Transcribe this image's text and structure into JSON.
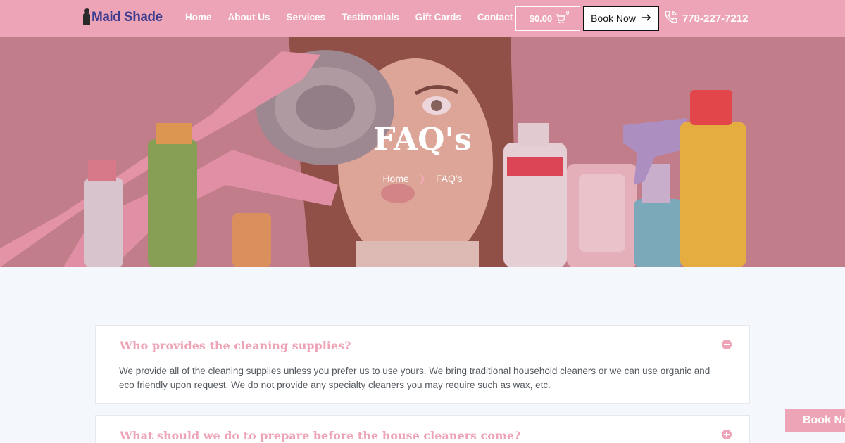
{
  "header": {
    "logo_text": "Maid Shade",
    "nav": [
      "Home",
      "About Us",
      "Services",
      "Testimonials",
      "Gift Cards",
      "Contact"
    ],
    "cart_total": "$0.00",
    "cart_count": "0",
    "book_label": "Book Now",
    "phone": "778-227-7212"
  },
  "hero": {
    "title": "FAQ's",
    "breadcrumb_home": "Home",
    "breadcrumb_current": "FAQ's"
  },
  "faqs": [
    {
      "question": "Who provides the cleaning supplies?",
      "answer": "We provide all of the cleaning supplies unless you prefer us to use yours. We bring traditional household cleaners or we can use organic and eco friendly upon request. We do not provide any specialty cleaners you may require such as wax, etc.",
      "expanded": true
    },
    {
      "question": "What should we do to prepare before the house cleaners come?",
      "expanded": false
    }
  ],
  "floating": {
    "book_label": "Book No"
  },
  "colors": {
    "brand_pink": "#eda4b6",
    "logo_blue": "#3f3d8f",
    "page_bg": "#f4f7fc"
  },
  "icons": {
    "cart": "cart-icon",
    "arrow": "arrow-right-icon",
    "phone": "phone-icon",
    "collapse": "minus-circle-icon",
    "expand": "plus-circle-icon",
    "chevron": "chevron-right-icon"
  }
}
